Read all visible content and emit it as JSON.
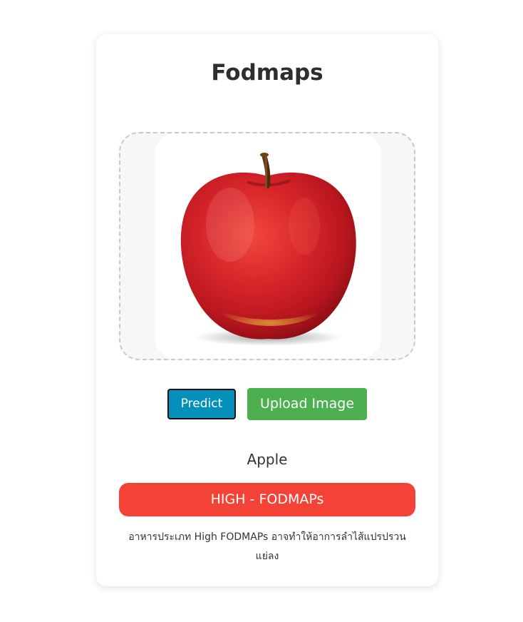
{
  "app": {
    "title": "Fodmaps"
  },
  "upload": {
    "image_subject": "Apple",
    "image_alt": "apple-image"
  },
  "actions": {
    "predict_label": "Predict",
    "upload_label": "Upload Image"
  },
  "result": {
    "food_name": "Apple",
    "fodmap_level": "HIGH - FODMAPs",
    "description": "อาหารประเภท High FODMAPs อาจทำให้อาการลำไส้แปรปรวนแย่ลง"
  },
  "colors": {
    "predict_button": "#0590bb",
    "upload_button": "#4caf50",
    "high_badge": "#f44336",
    "card_background": "#ffffff",
    "dropzone_background": "#f7f7f7",
    "dropzone_border": "#c9c9c9"
  },
  "icons": {
    "preview": "apple-image"
  }
}
